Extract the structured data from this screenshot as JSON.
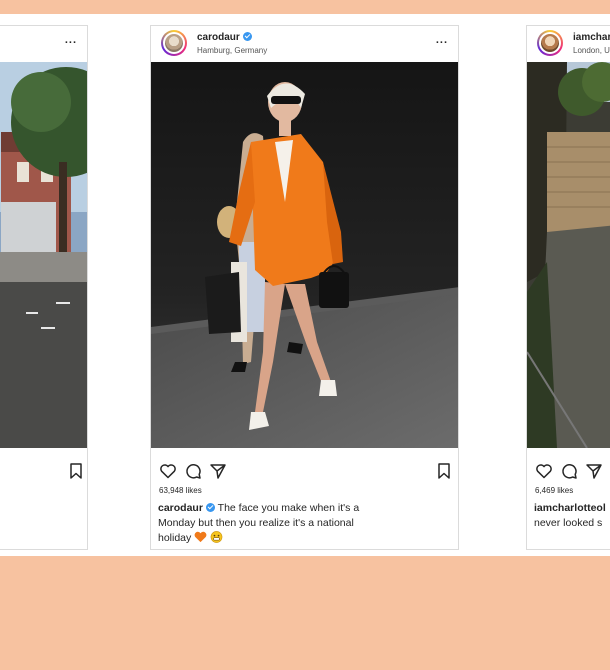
{
  "posts": [
    {
      "username": "",
      "location": "",
      "more_label": "...",
      "likes": "",
      "caption": ""
    },
    {
      "username": "carodaur",
      "location": "Hamburg, Germany",
      "more_label": "...",
      "likes": "63,948 likes",
      "caption_user": "carodaur",
      "caption": "The face you make when it's a Monday but then you realize it's a national holiday"
    },
    {
      "username": "iamcharlo",
      "location": "London, Uni",
      "more_label": "",
      "likes": "6,469 likes",
      "caption_user": "iamcharlotteol",
      "caption": "never looked s"
    }
  ],
  "colors": {
    "background": "#f7c2a0",
    "card": "#ffffff",
    "verified": "#3897f0",
    "jacket": "#f07a1a"
  },
  "icons": [
    "heart-icon",
    "comment-icon",
    "share-icon",
    "bookmark-icon",
    "verified-badge-icon",
    "more-options-icon"
  ]
}
